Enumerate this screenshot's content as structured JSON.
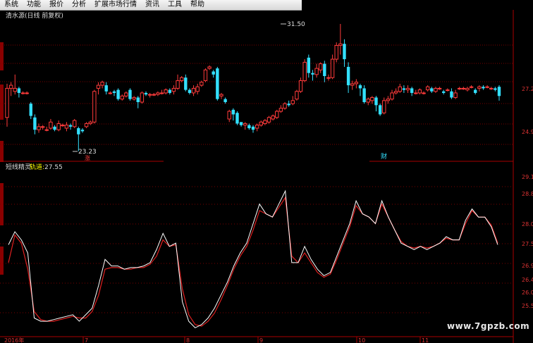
{
  "menu": [
    "系统",
    "功能",
    "报价",
    "分析",
    "扩展市场行情",
    "资讯",
    "工具",
    "帮助"
  ],
  "stock": {
    "title": "清水源(日线 前复权)"
  },
  "price_axis": {
    "labels": [
      "27.2",
      "24.9"
    ],
    "values": [
      27.2,
      24.9
    ],
    "ylim": [
      22.8,
      32.5
    ]
  },
  "price_annotations": {
    "high": "31.50",
    "low": "23.23",
    "low_badge": "涨",
    "event_badge": "财"
  },
  "indicator": {
    "name": "短线精灵",
    "line_label": "轨道:",
    "line_value": "27.55"
  },
  "indicator_axis": {
    "labels": [
      "29.1",
      "28.8",
      "28.0",
      "27.5",
      "26.9",
      "26.4",
      "26.0",
      "25.5"
    ],
    "values": [
      29.1,
      28.6,
      28.0,
      27.5,
      26.9,
      26.4,
      26.0,
      25.5
    ],
    "ylim": [
      24.9,
      29.9
    ]
  },
  "date_axis": {
    "labels": [
      "2016年",
      "7",
      "8",
      "9",
      "10",
      "11"
    ]
  },
  "watermark": "www.7gpzb.com",
  "colors": {
    "up": "#ff3b3b",
    "down": "#33e0ff",
    "axis": "#aa0000",
    "grid": "#7a0000",
    "line_white": "#ffffff",
    "line_red": "#e02020",
    "title": "#dddddd",
    "text_yellow": "#ffff00"
  },
  "chart_data": {
    "type": "candlestick",
    "title": "清水源(日线 前复权)",
    "candles": [
      [
        25.4,
        27.3,
        24.8,
        27.6
      ],
      [
        27.3,
        27.5,
        26.8,
        27.7
      ],
      [
        27.1,
        27.3,
        26.9,
        28.2
      ],
      [
        27.3,
        27.0,
        26.7,
        27.4
      ],
      [
        27.0,
        27.0,
        26.9,
        27.1
      ],
      [
        27.0,
        27.0,
        26.9,
        27.1
      ],
      [
        26.3,
        25.5,
        25.3,
        26.4
      ],
      [
        25.4,
        24.6,
        24.3,
        25.6
      ],
      [
        24.6,
        24.8,
        24.4,
        25.0
      ],
      [
        24.8,
        24.8,
        24.6,
        24.9
      ],
      [
        24.6,
        24.6,
        24.5,
        24.8
      ],
      [
        24.7,
        25.1,
        24.6,
        25.3
      ],
      [
        24.8,
        24.6,
        24.5,
        24.9
      ],
      [
        24.6,
        25.0,
        24.5,
        25.2
      ],
      [
        24.9,
        24.9,
        24.8,
        25.0
      ],
      [
        24.7,
        24.9,
        24.5,
        25.1
      ],
      [
        24.9,
        24.8,
        24.6,
        25.0
      ],
      [
        24.8,
        25.2,
        24.7,
        25.3
      ],
      [
        24.7,
        24.3,
        23.2,
        24.8
      ],
      [
        24.6,
        24.5,
        24.4,
        24.7
      ],
      [
        24.8,
        25.0,
        24.7,
        25.1
      ],
      [
        25.0,
        25.1,
        24.9,
        25.2
      ],
      [
        25.1,
        27.1,
        25.0,
        27.2
      ],
      [
        27.3,
        27.5,
        26.9,
        27.7
      ],
      [
        27.5,
        27.7,
        27.3,
        27.8
      ],
      [
        27.5,
        27.1,
        26.9,
        27.7
      ],
      [
        27.0,
        27.0,
        26.9,
        27.1
      ],
      [
        27.1,
        27.0,
        26.8,
        27.2
      ],
      [
        27.2,
        26.6,
        26.5,
        27.3
      ],
      [
        26.6,
        26.8,
        26.5,
        26.9
      ],
      [
        26.8,
        27.0,
        26.7,
        27.1
      ],
      [
        27.2,
        26.6,
        26.5,
        27.3
      ],
      [
        26.6,
        26.7,
        26.5,
        26.8
      ],
      [
        26.7,
        26.4,
        26.0,
        26.8
      ],
      [
        26.4,
        27.0,
        26.3,
        27.1
      ],
      [
        27.0,
        26.9,
        26.8,
        27.1
      ],
      [
        26.9,
        26.9,
        26.7,
        27.0
      ],
      [
        26.9,
        26.9,
        26.8,
        27.0
      ],
      [
        26.9,
        27.0,
        26.8,
        27.1
      ],
      [
        27.0,
        27.0,
        26.9,
        27.2
      ],
      [
        27.0,
        27.2,
        26.9,
        27.3
      ],
      [
        27.2,
        27.0,
        26.9,
        27.3
      ],
      [
        27.1,
        27.3,
        26.9,
        27.5
      ],
      [
        27.3,
        27.8,
        27.2,
        28.2
      ],
      [
        27.8,
        28.0,
        27.7,
        28.1
      ],
      [
        28.0,
        27.2,
        27.1,
        28.2
      ],
      [
        27.2,
        27.0,
        26.9,
        27.3
      ],
      [
        27.0,
        27.3,
        26.8,
        27.5
      ],
      [
        27.1,
        27.4,
        26.9,
        27.6
      ],
      [
        27.5,
        27.7,
        27.4,
        27.8
      ],
      [
        27.8,
        28.5,
        27.7,
        28.6
      ],
      [
        28.6,
        28.7,
        28.5,
        28.8
      ],
      [
        28.4,
        28.2,
        28.0,
        28.5
      ],
      [
        28.6,
        26.6,
        26.5,
        28.7
      ],
      [
        26.8,
        26.9,
        26.6,
        27.0
      ],
      [
        26.6,
        26.4,
        26.3,
        26.7
      ],
      [
        25.3,
        25.8,
        25.1,
        25.9
      ],
      [
        25.9,
        25.6,
        25.2,
        26.0
      ],
      [
        25.7,
        25.0,
        24.9,
        25.8
      ],
      [
        25.1,
        24.9,
        24.8,
        25.0
      ],
      [
        24.9,
        25.0,
        24.6,
        25.1
      ],
      [
        24.9,
        24.7,
        24.6,
        25.0
      ],
      [
        24.8,
        24.6,
        24.4,
        24.9
      ],
      [
        24.7,
        24.9,
        24.5,
        25.0
      ],
      [
        24.9,
        25.1,
        24.8,
        25.2
      ],
      [
        25.0,
        25.2,
        24.9,
        25.3
      ],
      [
        25.1,
        25.4,
        25.0,
        25.5
      ],
      [
        25.3,
        25.5,
        25.2,
        25.6
      ],
      [
        25.4,
        25.8,
        25.3,
        25.9
      ],
      [
        25.8,
        26.0,
        25.7,
        26.2
      ],
      [
        26.0,
        26.3,
        25.9,
        26.4
      ],
      [
        26.3,
        26.2,
        26.1,
        26.5
      ],
      [
        26.3,
        26.5,
        26.2,
        26.8
      ],
      [
        26.6,
        27.1,
        26.5,
        27.2
      ],
      [
        27.1,
        27.8,
        27.0,
        28.0
      ],
      [
        27.8,
        29.0,
        27.7,
        29.2
      ],
      [
        29.3,
        28.3,
        28.0,
        29.5
      ],
      [
        28.3,
        28.2,
        27.8,
        28.5
      ],
      [
        28.2,
        28.6,
        28.0,
        28.9
      ],
      [
        28.5,
        28.9,
        28.3,
        29.0
      ],
      [
        28.9,
        28.1,
        27.7,
        29.1
      ],
      [
        28.0,
        28.0,
        27.8,
        28.2
      ],
      [
        28.0,
        29.2,
        27.9,
        29.5
      ],
      [
        29.2,
        30.1,
        29.0,
        30.3
      ],
      [
        30.1,
        30.2,
        29.5,
        31.5
      ],
      [
        30.2,
        29.2,
        28.7,
        30.5
      ],
      [
        28.7,
        27.5,
        27.0,
        29.0
      ],
      [
        27.5,
        27.6,
        27.2,
        27.8
      ],
      [
        27.6,
        27.7,
        27.3,
        27.9
      ],
      [
        27.5,
        27.3,
        26.8,
        27.6
      ],
      [
        27.3,
        26.4,
        26.3,
        27.5
      ],
      [
        26.4,
        26.6,
        26.2,
        26.7
      ],
      [
        26.5,
        26.7,
        26.3,
        26.8
      ],
      [
        26.7,
        26.2,
        25.8,
        26.8
      ],
      [
        26.2,
        25.6,
        25.5,
        26.3
      ],
      [
        25.7,
        26.5,
        25.6,
        26.7
      ],
      [
        26.5,
        26.6,
        26.3,
        26.8
      ],
      [
        26.6,
        27.0,
        26.5,
        27.2
      ],
      [
        27.0,
        27.1,
        26.9,
        27.3
      ],
      [
        27.1,
        27.4,
        27.0,
        27.6
      ],
      [
        27.3,
        27.2,
        27.0,
        27.5
      ],
      [
        27.2,
        27.3,
        27.0,
        27.5
      ],
      [
        27.3,
        27.0,
        26.8,
        27.4
      ],
      [
        27.0,
        27.0,
        26.9,
        27.2
      ],
      [
        27.0,
        27.2,
        26.9,
        27.3
      ],
      [
        27.0,
        27.0,
        26.9,
        27.1
      ],
      [
        27.2,
        27.4,
        27.1,
        27.5
      ],
      [
        27.3,
        27.1,
        27.0,
        27.4
      ],
      [
        27.1,
        27.3,
        27.0,
        27.4
      ],
      [
        27.3,
        27.3,
        27.2,
        27.4
      ],
      [
        27.1,
        27.0,
        26.9,
        27.2
      ],
      [
        27.2,
        27.2,
        27.1,
        27.3
      ],
      [
        27.1,
        26.7,
        26.6,
        27.3
      ],
      [
        26.7,
        27.0,
        26.6,
        27.2
      ],
      [
        27.3,
        27.3,
        27.2,
        27.4
      ],
      [
        27.3,
        27.3,
        27.2,
        27.4
      ],
      [
        27.2,
        27.3,
        27.1,
        27.4
      ],
      [
        27.4,
        27.4,
        27.3,
        27.5
      ],
      [
        27.2,
        27.0,
        26.9,
        27.3
      ],
      [
        27.3,
        27.4,
        27.1,
        27.5
      ],
      [
        27.4,
        27.3,
        27.2,
        27.5
      ],
      [
        27.4,
        27.4,
        27.3,
        27.5
      ],
      [
        27.3,
        27.3,
        27.2,
        27.4
      ],
      [
        27.3,
        27.2,
        27.1,
        27.4
      ],
      [
        27.4,
        26.8,
        26.5,
        27.5
      ]
    ],
    "indicator_white": [
      27.55,
      27.95,
      27.7,
      27.3,
      25.3,
      25.2,
      25.2,
      25.25,
      25.3,
      25.35,
      25.4,
      25.2,
      25.4,
      25.6,
      26.3,
      27.1,
      26.9,
      26.9,
      26.8,
      26.85,
      26.85,
      26.9,
      27.0,
      27.4,
      27.9,
      27.5,
      27.6,
      25.8,
      25.2,
      25.0,
      25.1,
      25.3,
      25.6,
      26.0,
      26.4,
      26.9,
      27.3,
      27.6,
      28.2,
      28.8,
      28.5,
      28.4,
      28.8,
      29.2,
      27.0,
      27.0,
      27.5,
      27.1,
      26.8,
      26.6,
      26.7,
      27.2,
      27.7,
      28.2,
      28.9,
      28.5,
      28.4,
      28.2,
      28.9,
      28.4,
      28.0,
      27.6,
      27.5,
      27.4,
      27.5,
      27.4,
      27.5,
      27.6,
      27.8,
      27.7,
      27.7,
      28.3,
      28.65,
      28.4,
      28.4,
      28.1,
      27.55
    ],
    "indicator_red": [
      27.0,
      27.85,
      27.6,
      26.8,
      25.5,
      25.25,
      25.2,
      25.2,
      25.25,
      25.3,
      25.35,
      25.3,
      25.3,
      25.5,
      26.0,
      26.8,
      26.85,
      26.85,
      26.8,
      26.8,
      26.85,
      26.85,
      26.95,
      27.2,
      27.7,
      27.5,
      27.55,
      26.2,
      25.4,
      25.1,
      25.05,
      25.2,
      25.45,
      25.85,
      26.3,
      26.8,
      27.2,
      27.5,
      28.0,
      28.6,
      28.5,
      28.4,
      28.7,
      29.0,
      27.2,
      27.0,
      27.3,
      27.0,
      26.7,
      26.55,
      26.65,
      27.1,
      27.6,
      28.1,
      28.75,
      28.5,
      28.4,
      28.2,
      28.8,
      28.4,
      28.0,
      27.65,
      27.5,
      27.45,
      27.5,
      27.45,
      27.5,
      27.6,
      27.75,
      27.7,
      27.7,
      28.2,
      28.6,
      28.4,
      28.4,
      28.15,
      27.6
    ]
  }
}
